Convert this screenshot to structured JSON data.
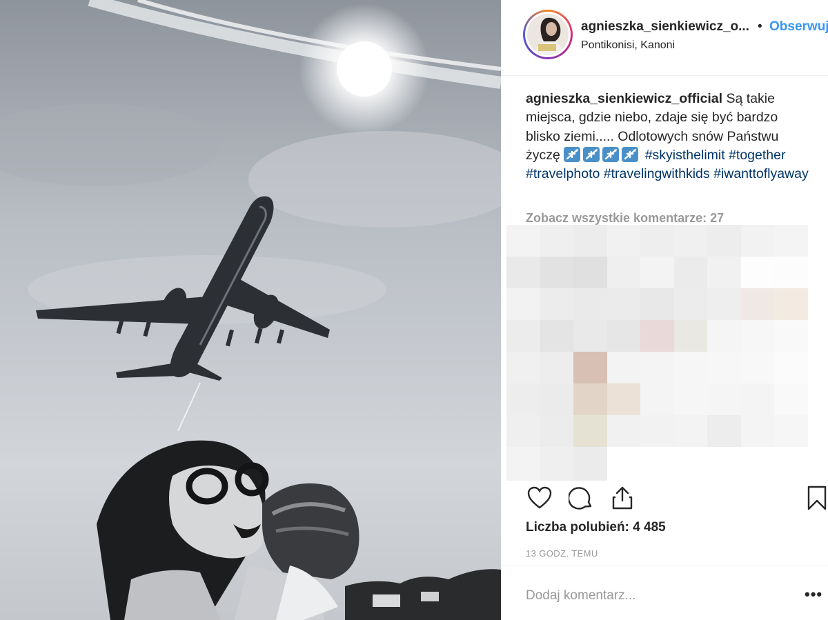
{
  "post": {
    "username": "agnieszka_sienkiewicz_o...",
    "separator": "•",
    "follow_label": "Obserwuj",
    "location": "Pontikonisi, Kanoni"
  },
  "caption": {
    "user": "agnieszka_sienkiewicz_official",
    "text": "Są takie miejsca, gdzie niebo, zdaje się być bardzo blisko ziemi..... Odlotowych snów Państwu życzę",
    "emoji_count": 4,
    "hashtags": [
      "#skyisthelimit",
      "#together",
      "#travelphoto",
      "#travelingwithkids",
      "#iwanttoflyaway"
    ]
  },
  "comments": {
    "view_all": "Zobacz wszystkie komentarze: 27"
  },
  "actions": {
    "like_icon": "heart-icon",
    "comment_icon": "comment-icon",
    "share_icon": "share-icon",
    "save_icon": "bookmark-icon"
  },
  "likes": "Liczba polubień: 4 485",
  "timestamp": "13 GODZ. TEMU",
  "comment_box": {
    "placeholder": "Dodaj komentarz...",
    "more": "•••"
  },
  "colors": {
    "link_blue": "#3897f0",
    "hashtag": "#003569",
    "muted": "#999999"
  }
}
